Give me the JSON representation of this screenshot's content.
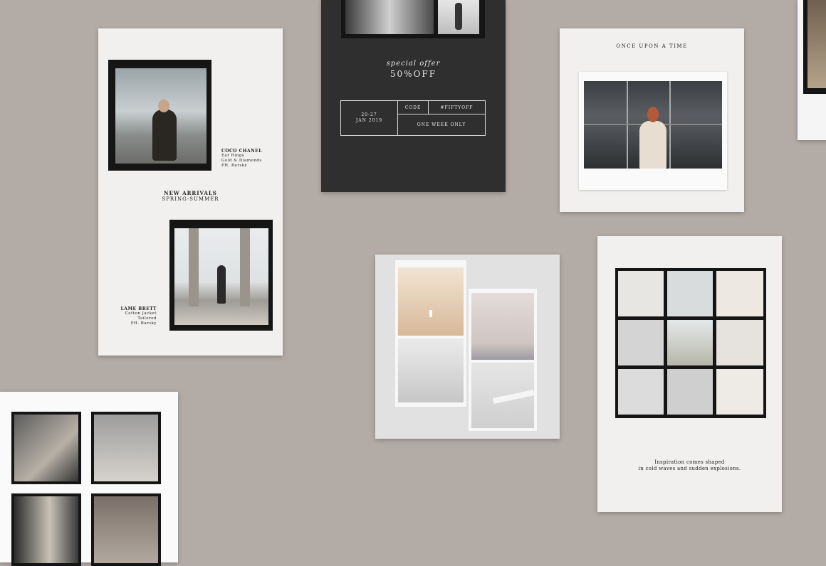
{
  "card1": {
    "caption1": {
      "title": "COCO CHANEL",
      "line1": "Ear Rings",
      "line2": "Gold & Diamonds",
      "line3": "PH. Barsky"
    },
    "heading": {
      "line1": "NEW ARRIVALS",
      "line2": "SPRING-SUMMER"
    },
    "caption2": {
      "title": "LAME BRETT",
      "line1": "Cotton Jacket",
      "line2": "Tailored",
      "line3": "PH. Barsky"
    }
  },
  "card2": {
    "script_text": "special offer",
    "offer": "50%OFF",
    "dates": {
      "line1": "20-27",
      "line2": "JAN 2019"
    },
    "code_label": "CODE",
    "code_value": "#FIFTYOFF",
    "duration": "ONE WEEK ONLY"
  },
  "card3": {
    "title": "ONCE UPON A TIME"
  },
  "card5": {
    "quote": {
      "line1": "Inspiration comes shaped",
      "line2": "in cold waves and sudden explosions."
    }
  },
  "colors": {
    "background": "#b3aca6",
    "dark_card": "#2f2f2f",
    "light_card": "#f1f0ee"
  }
}
